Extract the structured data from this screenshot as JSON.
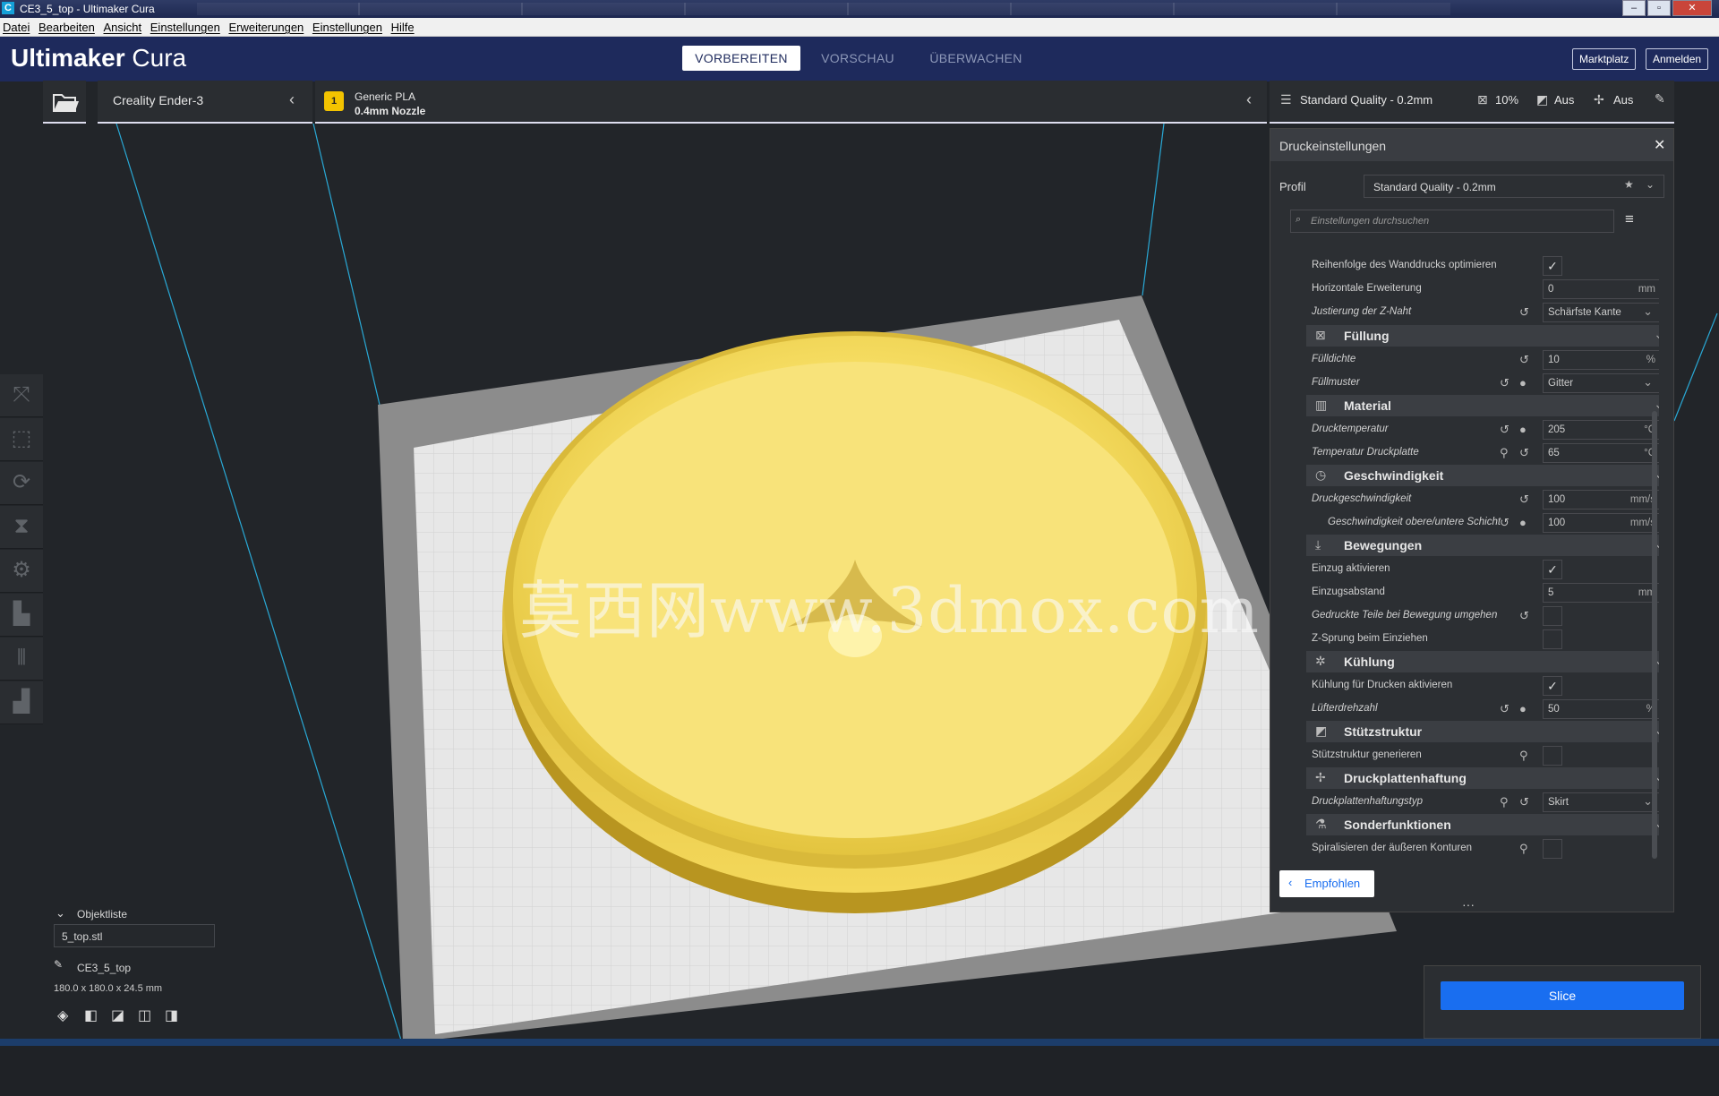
{
  "window": {
    "title": "CE3_5_top - Ultimaker Cura",
    "app_icon": "C"
  },
  "menu": [
    "Datei",
    "Bearbeiten",
    "Ansicht",
    "Einstellungen",
    "Erweiterungen",
    "Einstellungen",
    "Hilfe"
  ],
  "header": {
    "logo_bold": "Ultimaker",
    "logo_light": " Cura",
    "tabs": [
      {
        "label": "VORBEREITEN",
        "active": true
      },
      {
        "label": "VORSCHAU",
        "active": false
      },
      {
        "label": "ÜBERWACHEN",
        "active": false
      }
    ],
    "marketplace": "Marktplatz",
    "signin": "Anmelden"
  },
  "toolbar": {
    "machine": "Creality Ender-3",
    "material_name": "Generic PLA",
    "nozzle": "0.4mm Nozzle",
    "extruder_number": "1",
    "quality": "Standard Quality - 0.2mm",
    "infill": "10%",
    "support": "Aus",
    "adhesion": "Aus"
  },
  "panel": {
    "title": "Druckeinstellungen",
    "profile_label": "Profil",
    "profile_value": "Standard Quality - 0.2mm",
    "search_placeholder": "Einstellungen durchsuchen",
    "recommended_button": "Empfohlen",
    "rows": {
      "r1": {
        "label": "Reihenfolge des Wanddrucks optimieren",
        "checked": "✓"
      },
      "r2": {
        "label": "Horizontale Erweiterung",
        "value": "0",
        "unit": "mm"
      },
      "r3": {
        "label": "Justierung der Z-Naht",
        "value": "Schärfste Kante"
      },
      "cat_fill": "Füllung",
      "r4": {
        "label": "Fülldichte",
        "value": "10",
        "unit": "%"
      },
      "r5": {
        "label": "Füllmuster",
        "value": "Gitter"
      },
      "cat_material": "Material",
      "r6": {
        "label": "Drucktemperatur",
        "value": "205",
        "unit": "°C"
      },
      "r7": {
        "label": "Temperatur Druckplatte",
        "value": "65",
        "unit": "°C"
      },
      "cat_speed": "Geschwindigkeit",
      "r8": {
        "label": "Druckgeschwindigkeit",
        "value": "100",
        "unit": "mm/s"
      },
      "r9": {
        "label": "Geschwindigkeit obere/untere Schicht",
        "value": "100",
        "unit": "mm/s"
      },
      "cat_travel": "Bewegungen",
      "r10": {
        "label": "Einzug aktivieren",
        "checked": "✓"
      },
      "r11": {
        "label": "Einzugsabstand",
        "value": "5",
        "unit": "mm"
      },
      "r12": {
        "label": "Gedruckte Teile bei Bewegung umgehen",
        "checked": ""
      },
      "r13": {
        "label": "Z-Sprung beim Einziehen",
        "checked": ""
      },
      "cat_cooling": "Kühlung",
      "r14": {
        "label": "Kühlung für Drucken aktivieren",
        "checked": "✓"
      },
      "r15": {
        "label": "Lüfterdrehzahl",
        "value": "50",
        "unit": "%"
      },
      "cat_support": "Stützstruktur",
      "r16": {
        "label": "Stützstruktur generieren",
        "checked": ""
      },
      "cat_adhesion": "Druckplattenhaftung",
      "r17": {
        "label": "Druckplattenhaftungstyp",
        "value": "Skirt"
      },
      "cat_special": "Sonderfunktionen",
      "r18": {
        "label": "Spiralisieren der äußeren Konturen",
        "checked": ""
      }
    }
  },
  "objects": {
    "header": "Objektliste",
    "file": "5_top.stl",
    "name": "CE3_5_top",
    "dimensions": "180.0 x 180.0 x 24.5 mm"
  },
  "slice_button": "Slice",
  "watermark": "莫西网www.3dmox.com"
}
